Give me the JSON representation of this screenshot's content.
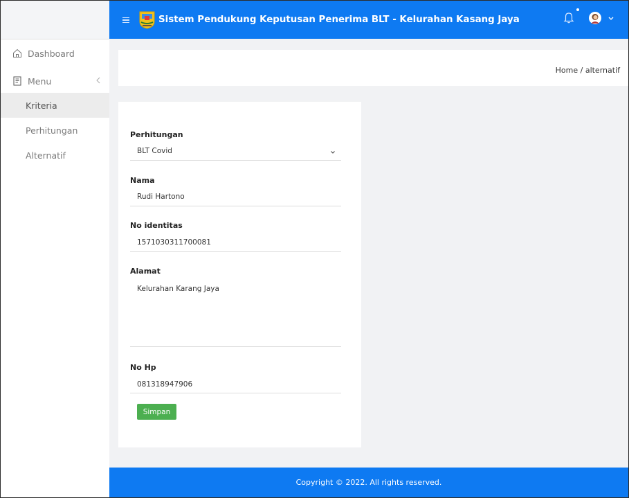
{
  "header": {
    "title": "Sistem Pendukung Keputusan Penerima BLT - Kelurahan Kasang Jaya",
    "color": "#0e7af2"
  },
  "sidebar": {
    "dashboard": "Dashboard",
    "menu": "Menu",
    "items": [
      "Kriteria",
      "Perhitungan",
      "Alternatif"
    ]
  },
  "breadcrumb": "Home / alternatif",
  "form": {
    "perhitungan_label": "Perhitungan",
    "perhitungan_value": "BLT Covid",
    "nama_label": "Nama",
    "nama_value": "Rudi Hartono",
    "noid_label": "No identitas",
    "noid_value": "1571030311700081",
    "alamat_label": "Alamat",
    "alamat_value": "Kelurahan Karang Jaya",
    "nohp_label": "No Hp",
    "nohp_value": "081318947906",
    "save_label": "Simpan"
  },
  "footer": "Copyright © 2022. All rights reserved."
}
